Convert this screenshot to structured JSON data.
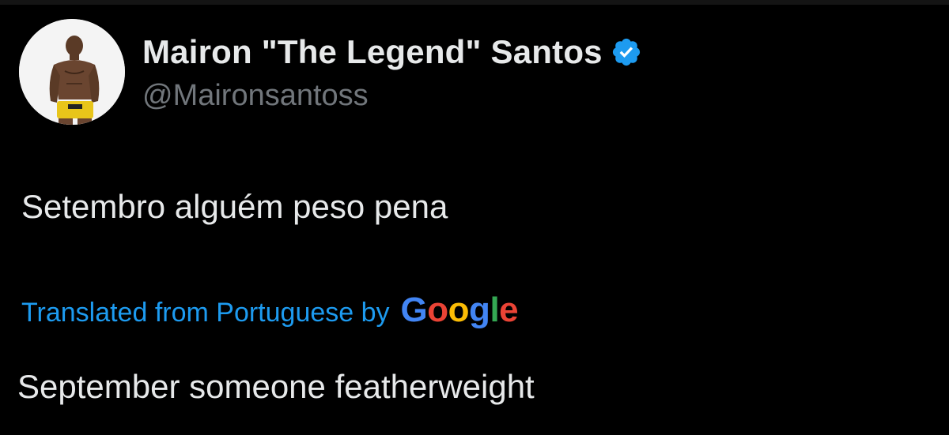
{
  "tweet": {
    "author": {
      "display_name": "Mairon \"The Legend\" Santos",
      "handle": "@Maironsantoss",
      "verified": true
    },
    "text": "Setembro alguém peso pena",
    "translation": {
      "label": "Translated from Portuguese by",
      "provider": "Google",
      "provider_colors": [
        "#4285F4",
        "#EA4335",
        "#FBBC05",
        "#4285F4",
        "#34A853",
        "#EA4335"
      ],
      "text": "September someone featherweight"
    }
  },
  "colors": {
    "background": "#000000",
    "primary_text": "#e7e9ea",
    "secondary_text": "#71767b",
    "link": "#1d9bf0",
    "verified_badge": "#1d9bf0"
  },
  "icons": {
    "verified": "verified-badge-icon",
    "avatar": "profile-photo"
  }
}
